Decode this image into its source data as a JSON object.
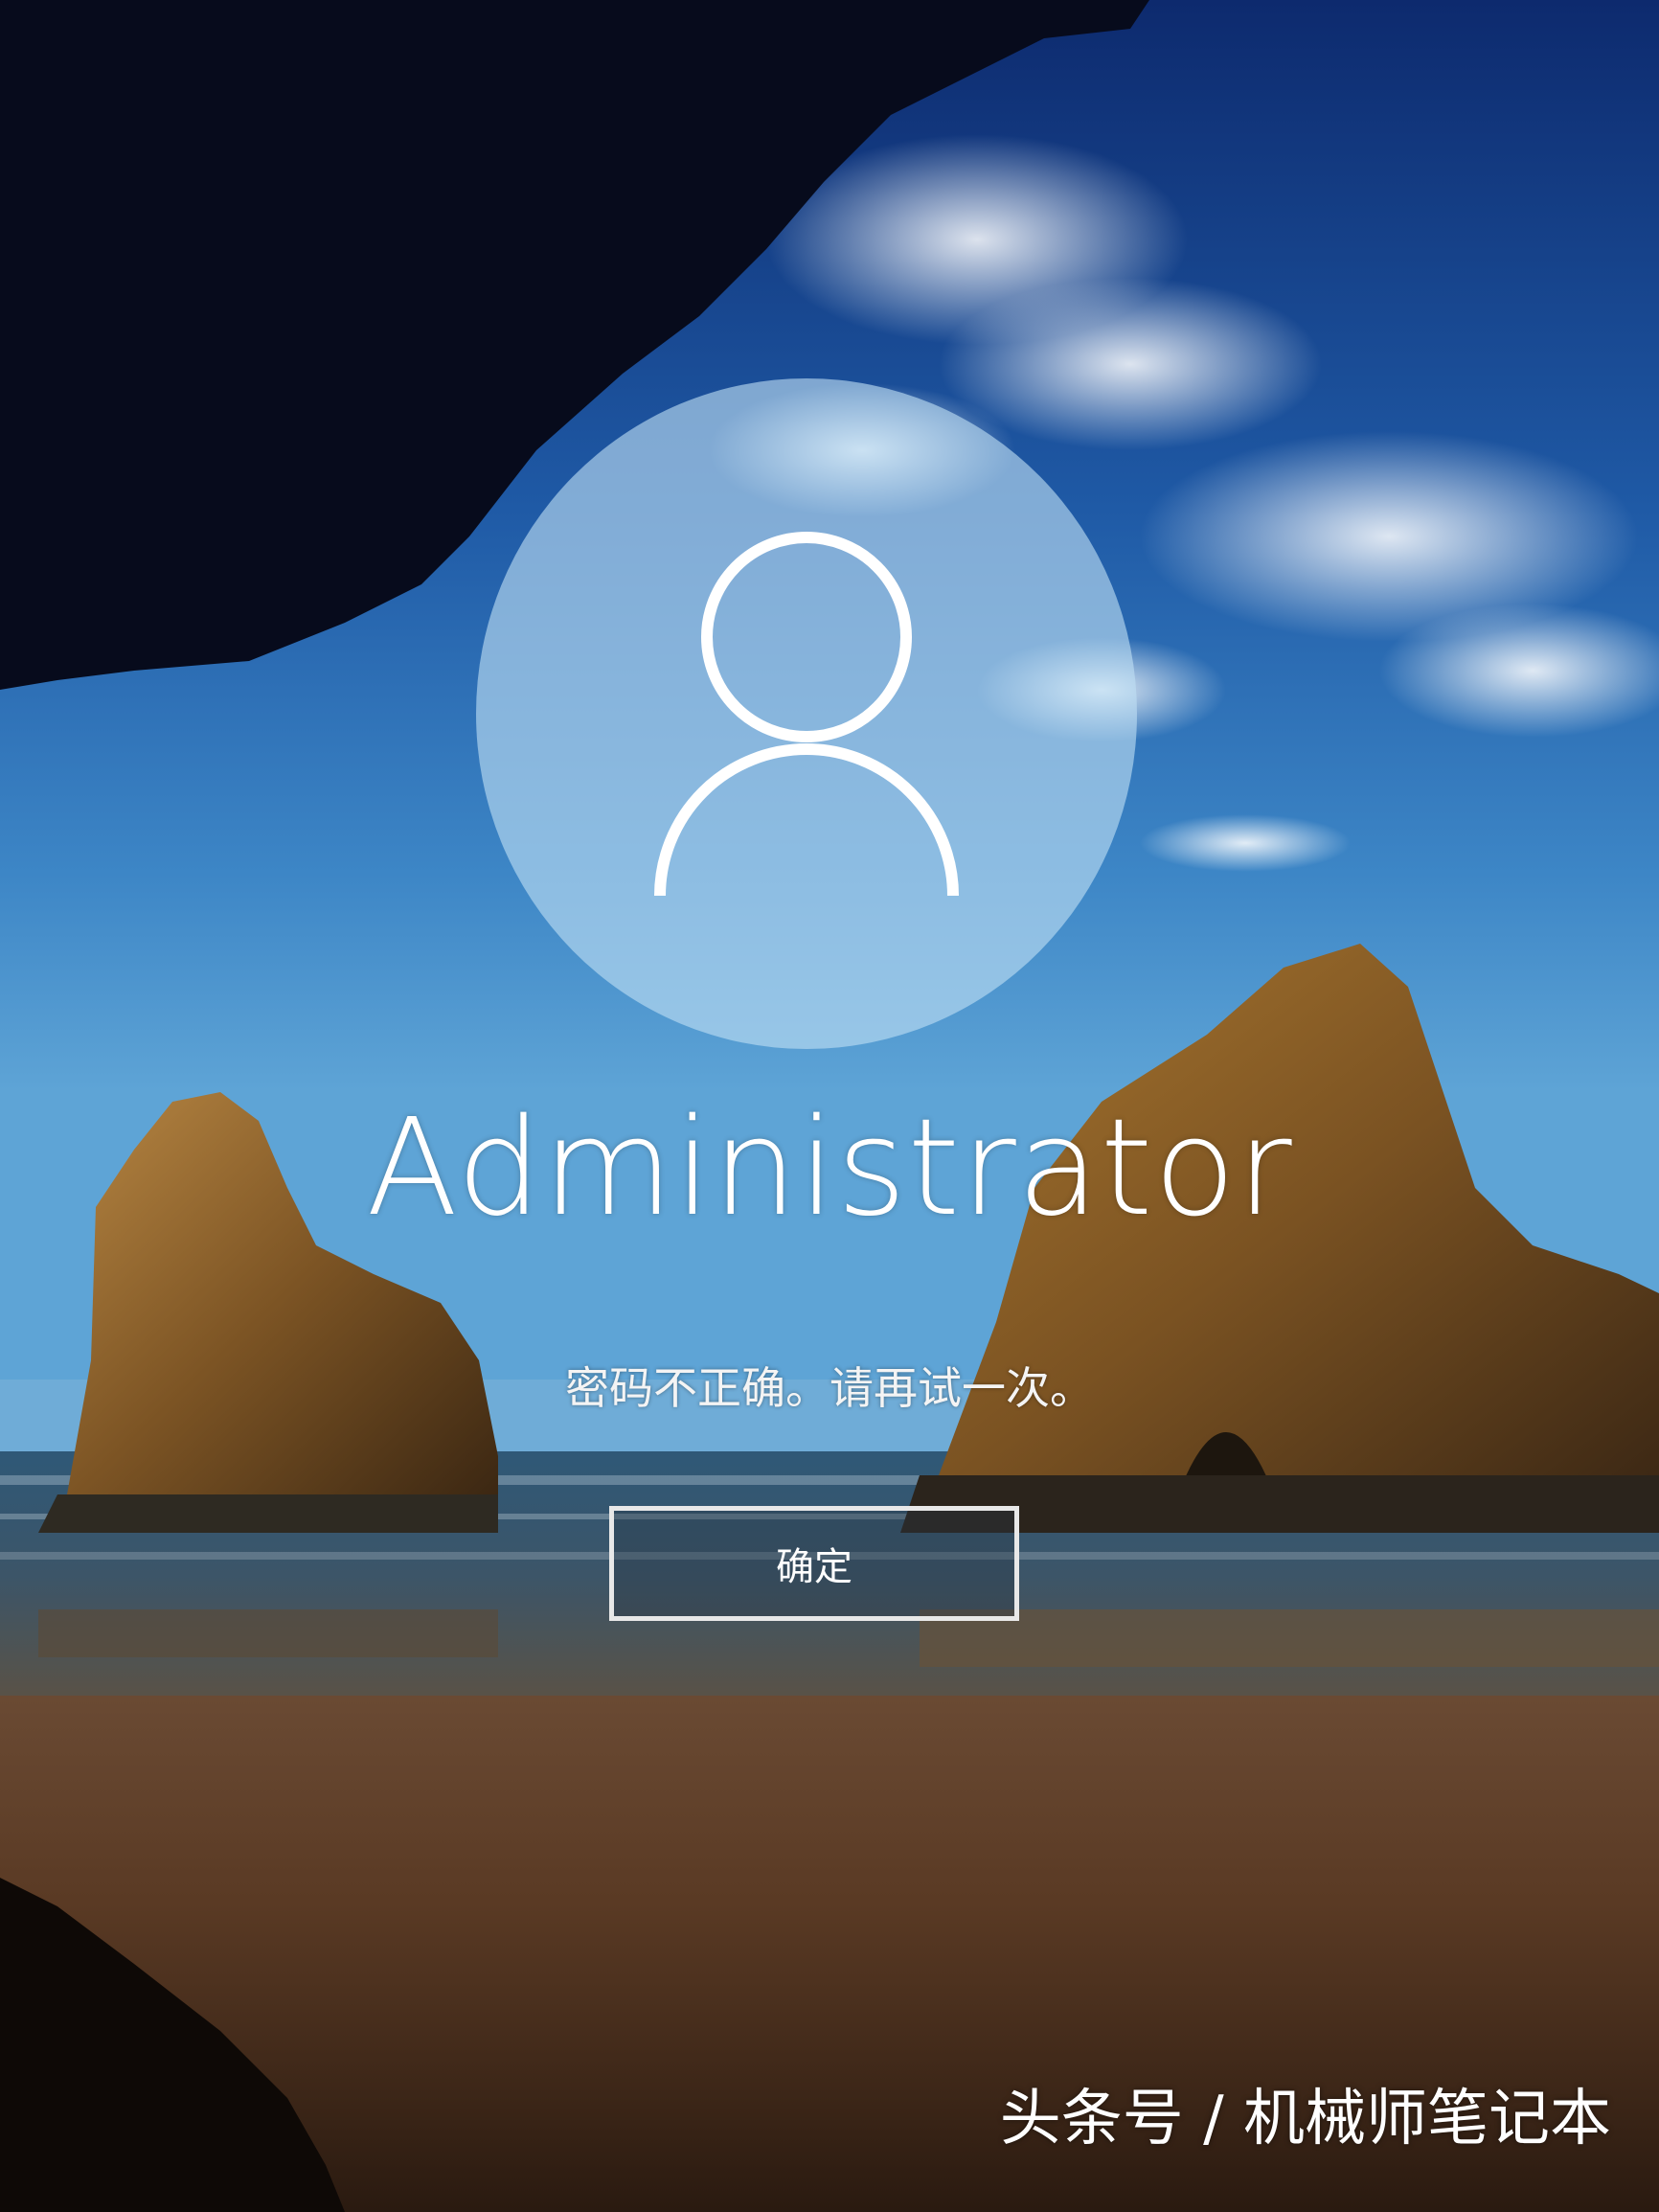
{
  "lockscreen": {
    "username": "Administrator",
    "error_message": "密码不正确。请再试一次。",
    "ok_button_label": "确定",
    "avatar_icon": "user-silhouette-icon"
  },
  "watermark": {
    "text": "头条号 / 机械师笔记本"
  },
  "colors": {
    "text": "#ffffff",
    "avatar_circle": "#bedef4",
    "button_border": "#e8e8e8"
  }
}
